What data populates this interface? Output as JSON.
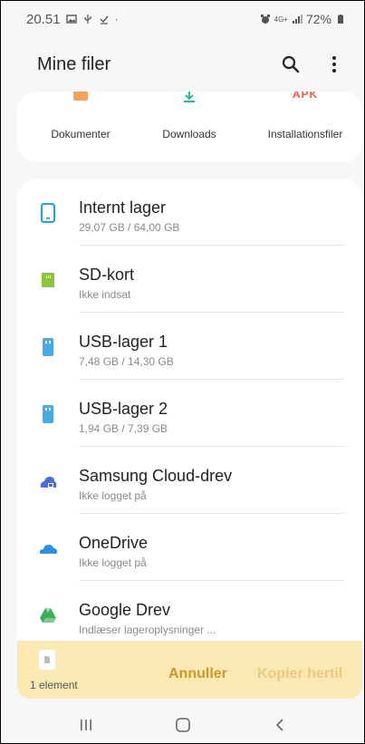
{
  "status_bar": {
    "time": "20.51",
    "battery_percent": "72%",
    "network_label": "4G+"
  },
  "header": {
    "title": "Mine filer",
    "actions": [
      "search-icon",
      "more-vert-icon"
    ]
  },
  "categories": [
    {
      "label": "Dokumenter",
      "icon": "document-icon",
      "color": "#f5a25d"
    },
    {
      "label": "Downloads",
      "icon": "download-icon",
      "color": "#2fb89b"
    },
    {
      "label": "Installationsfiler",
      "icon_text": "APK",
      "color": "#f25a3d"
    }
  ],
  "storage": [
    {
      "name": "Internt lager",
      "detail": "29,07 GB / 64,00 GB",
      "icon": "phone-icon",
      "color": "#2f9ed8"
    },
    {
      "name": "SD-kort",
      "detail": "Ikke indsat",
      "icon": "sd-card-icon",
      "color": "#8ac53f"
    },
    {
      "name": "USB-lager 1",
      "detail": "7,48 GB / 14,30 GB",
      "icon": "usb-icon",
      "color": "#4aa9e0"
    },
    {
      "name": "USB-lager 2",
      "detail": "1,94 GB / 7,39 GB",
      "icon": "usb-icon",
      "color": "#4aa9e0"
    },
    {
      "name": "Samsung Cloud-drev",
      "detail": "Ikke logget på",
      "icon": "samsung-cloud-icon",
      "color": "#4a6fd8"
    },
    {
      "name": "OneDrive",
      "detail": "Ikke logget på",
      "icon": "onedrive-icon",
      "color": "#2d8fe0"
    },
    {
      "name": "Google Drev",
      "detail": "Indlæser lageroplysninger ...",
      "icon": "google-drive-icon",
      "color": "#3fae5a"
    }
  ],
  "action_bar": {
    "count": "1 element",
    "cancel_label": "Annuller",
    "copy_label": "Kopier hertil"
  },
  "nav": [
    "recent-apps-icon",
    "home-icon",
    "back-icon"
  ]
}
